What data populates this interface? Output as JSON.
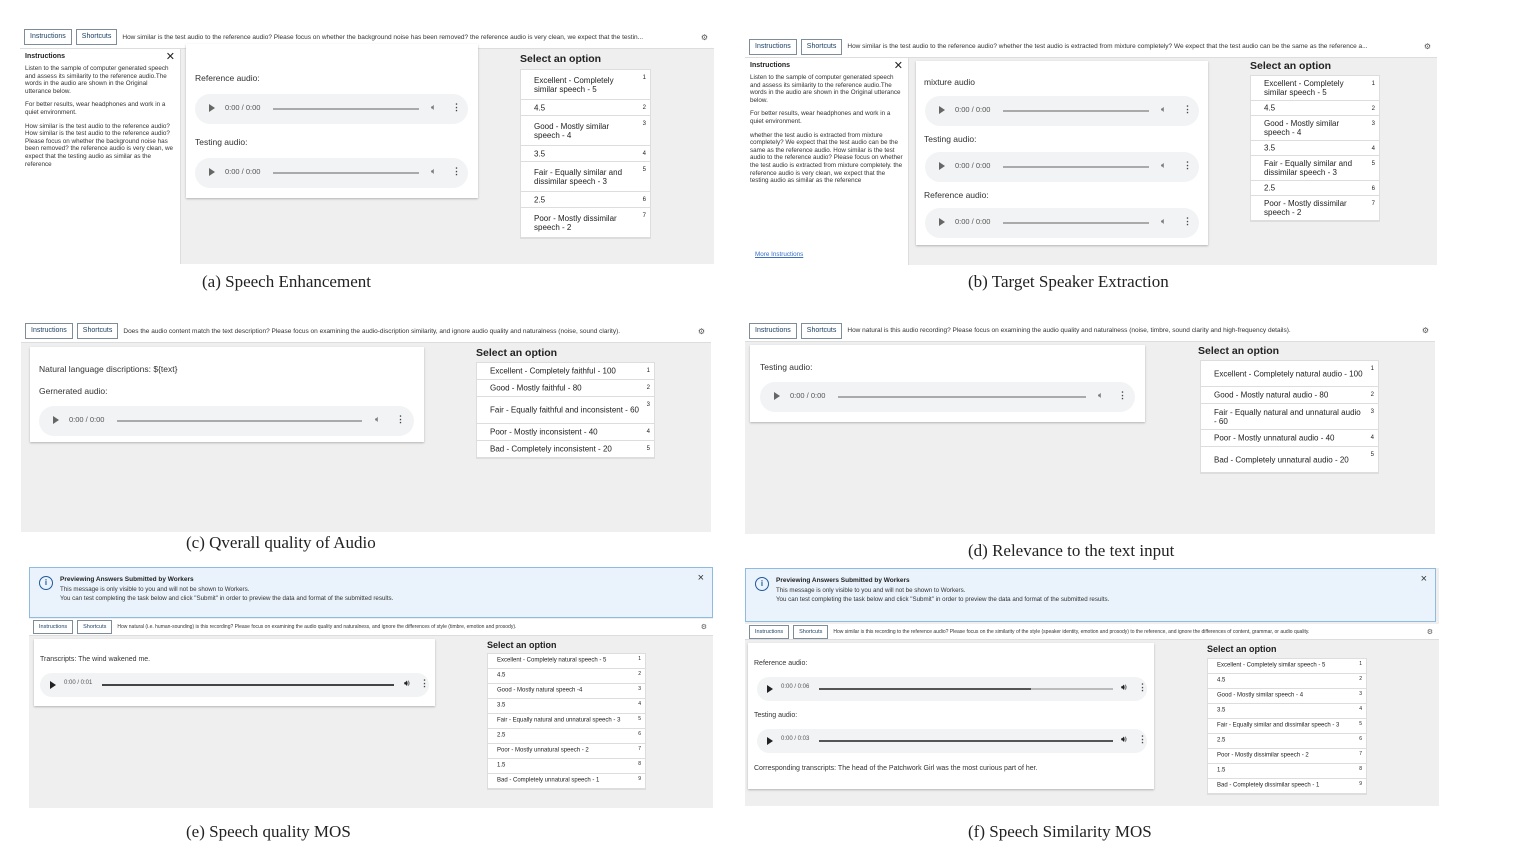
{
  "panels": {
    "a": {
      "caption": "(a)  Speech Enhancement",
      "instructions_btn": "Instructions",
      "shortcuts_btn": "Shortcuts",
      "question": "How similar is the test audio to the reference audio? Please focus on whether the background noise has been removed? the reference audio is very clean, we expect that the testin...",
      "sidebar_title": "Instructions",
      "sidebar_p1": "Listen to the sample of computer generated speech and assess its similarity to the reference audio.The words in the audio are shown in the Original utterance below.",
      "sidebar_p2": "For better results, wear headphones and work in a quiet environment.",
      "sidebar_p3": "How similar is the test audio to the reference audio? How similar is the test audio to the reference audio? Please focus on whether the background noise has been removed? the reference audio is very clean, we expect that the testing audio as similar as the reference",
      "label1": "Reference audio:",
      "label2": "Testing audio:",
      "player_time": "0:00 / 0:00",
      "select_title": "Select an option",
      "options": [
        {
          "text": "Excellent - Completely similar speech - 5",
          "key": "1"
        },
        {
          "text": "4.5",
          "key": "2"
        },
        {
          "text": "Good - Mostly similar speech - 4",
          "key": "3"
        },
        {
          "text": "3.5",
          "key": "4"
        },
        {
          "text": "Fair - Equally similar and dissimilar speech - 3",
          "key": "5"
        },
        {
          "text": "2.5",
          "key": "6"
        },
        {
          "text": "Poor - Mostly dissimilar speech - 2",
          "key": "7"
        }
      ]
    },
    "b": {
      "caption": "(b)  Target Speaker Extraction",
      "instructions_btn": "Instructions",
      "shortcuts_btn": "Shortcuts",
      "question": "How similar is the test audio to the reference audio? whether the test audio is extracted from mixture completely? We expect that the test audio can be the same as the reference a...",
      "sidebar_title": "Instructions",
      "sidebar_p1": "Listen to the sample of computer generated speech and assess its similarity to the reference audio.The words in the audio are shown in the Original utterance below.",
      "sidebar_p2": "For better results, wear headphones and work in a quiet environment.",
      "sidebar_p3": "whether the test audio is extracted from mixture completely? We expect that the test audio can be the same as the reference audio. How similar is the test audio to the reference audio? Please focus on whether the test audio is extracted from mixture completely. the reference audio is very clean, we expect that the testing audio as similar as the reference",
      "more": "More Instructions",
      "label1": "mixture audio",
      "label2": "Testing audio:",
      "label3": "Reference audio:",
      "player_time": "0:00 / 0:00",
      "select_title": "Select an option",
      "options": [
        {
          "text": "Excellent - Completely similar speech - 5",
          "key": "1"
        },
        {
          "text": "4.5",
          "key": "2"
        },
        {
          "text": "Good - Mostly similar speech - 4",
          "key": "3"
        },
        {
          "text": "3.5",
          "key": "4"
        },
        {
          "text": "Fair - Equally similar and dissimilar speech - 3",
          "key": "5"
        },
        {
          "text": "2.5",
          "key": "6"
        },
        {
          "text": "Poor - Mostly dissimilar speech - 2",
          "key": "7"
        }
      ]
    },
    "c": {
      "caption": "(c)  Qverall quality of Audio",
      "instructions_btn": "Instructions",
      "shortcuts_btn": "Shortcuts",
      "question": "Does the audio content match the text description? Please focus on examining the audio-discription similarity, and ignore audio quality and naturalness (noise, sound clarity).",
      "label1": "Natural language discriptions: ${text}",
      "label2": "Gernerated audio:",
      "player_time": "0:00 / 0:00",
      "select_title": "Select an option",
      "options": [
        {
          "text": "Excellent - Completely faithful - 100",
          "key": "1"
        },
        {
          "text": "Good - Mostly faithful - 80",
          "key": "2"
        },
        {
          "text": "Fair - Equally faithful and inconsistent - 60",
          "key": "3"
        },
        {
          "text": "Poor - Mostly inconsistent - 40",
          "key": "4"
        },
        {
          "text": "Bad - Completely inconsistent - 20",
          "key": "5"
        }
      ]
    },
    "d": {
      "caption": "(d)  Relevance to the text input",
      "instructions_btn": "Instructions",
      "shortcuts_btn": "Shortcuts",
      "question": "How natural is this audio recording? Please focus on examining the audio quality and naturalness (noise, timbre, sound clarity and high-frequency details).",
      "label1": "Testing audio:",
      "player_time": "0:00 / 0:00",
      "select_title": "Select an option",
      "options": [
        {
          "text": "Excellent - Completely natural audio - 100",
          "key": "1"
        },
        {
          "text": "Good - Mostly natural audio - 80",
          "key": "2"
        },
        {
          "text": "Fair - Equally natural and unnatural audio - 60",
          "key": "3"
        },
        {
          "text": "Poor - Mostly unnatural audio - 40",
          "key": "4"
        },
        {
          "text": "Bad - Completely unnatural audio - 20",
          "key": "5"
        }
      ]
    },
    "e": {
      "caption": "(e)  Speech quality MOS",
      "notice_title": "Previewing Answers Submitted by Workers",
      "notice_l1": "This message is only visible to you and will not be shown to Workers.",
      "notice_l2": "You can test completing the task below and click \"Submit\" in order to preview the data and format of the submitted results.",
      "instructions_btn": "Instructions",
      "shortcuts_btn": "Shortcuts",
      "question": "How natural (i.e. human-sounding) is this recording? Please focus on examining the audio quality and naturalness, and ignore the differences of style (timbre, emotion and prosody).",
      "transcript_label": "Transcripts:",
      "transcript": "The wind wakened me.",
      "player_time": "0:00 / 0:01",
      "player_progress": 0,
      "select_title": "Select an option",
      "options": [
        {
          "text": "Excellent - Completely natural speech - 5",
          "key": "1"
        },
        {
          "text": "4.5",
          "key": "2"
        },
        {
          "text": "Good - Mostly natural speech -4",
          "key": "3"
        },
        {
          "text": "3.5",
          "key": "4"
        },
        {
          "text": "Fair - Equally natural and unnatural speech - 3",
          "key": "5"
        },
        {
          "text": "2.5",
          "key": "6"
        },
        {
          "text": "Poor - Mostly unnatural speech - 2",
          "key": "7"
        },
        {
          "text": "1.5",
          "key": "8"
        },
        {
          "text": "Bad - Completely unnatural speech - 1",
          "key": "9"
        }
      ]
    },
    "f": {
      "caption": "(f)  Speech Similarity  MOS",
      "notice_title": "Previewing Answers Submitted by Workers",
      "notice_l1": "This message is only visible to you and will not be shown to Workers.",
      "notice_l2": "You can test completing the task below and click \"Submit\" in order to preview the data and format of the submitted results.",
      "instructions_btn": "Instructions",
      "shortcuts_btn": "Shortcuts",
      "question": "How similar is this recording to the reference audio? Please focus on the similarity of the style (speaker identity, emotion and prosody) to the reference, and ignore the differences of content, grammar, or audio quality.",
      "label1": "Reference audio:",
      "label2": "Testing audio:",
      "player1_time": "0:00 / 0:06",
      "player1_progress": 0.72,
      "player2_time": "0:00 / 0:03",
      "player2_progress": 1.0,
      "transcript_label": "Corresponding transcripts:",
      "transcript": "The head of the Patchwork Girl was the most curious part of her.",
      "select_title": "Select an option",
      "options": [
        {
          "text": "Excellent - Completely similar speech - 5",
          "key": "1"
        },
        {
          "text": "4.5",
          "key": "2"
        },
        {
          "text": "Good - Mostly similar speech - 4",
          "key": "3"
        },
        {
          "text": "3.5",
          "key": "4"
        },
        {
          "text": "Fair - Equally similar and dissimilar speech - 3",
          "key": "5"
        },
        {
          "text": "2.5",
          "key": "6"
        },
        {
          "text": "Poor - Mostly dissimilar speech - 2",
          "key": "7"
        },
        {
          "text": "1.5",
          "key": "8"
        },
        {
          "text": "Bad - Completely dissimilar speech - 1",
          "key": "9"
        }
      ]
    }
  },
  "icons": {
    "gear": "gear-icon",
    "close": "close-icon",
    "info": "info-icon",
    "play": "play-icon",
    "volume": "volume-icon",
    "menu": "more-vert-icon"
  }
}
